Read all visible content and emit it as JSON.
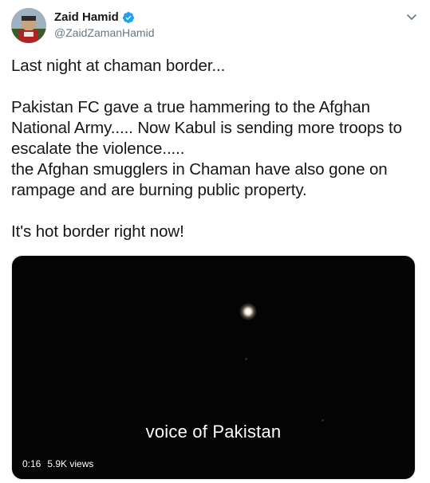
{
  "author": {
    "display_name": "Zaid Hamid",
    "handle": "@ZaidZamanHamid",
    "verified": true
  },
  "tweet": {
    "text": "Last night at chaman border...\n\nPakistan FC gave a true hammering to the Afghan National Army..... Now Kabul is sending more troops to escalate the violence.....\nthe Afghan smugglers in Chaman have also gone on rampage and are burning public property.\n\nIt's hot border right now!"
  },
  "media": {
    "caption": "voice of Pakistan",
    "duration": "0:16",
    "views": "5.9K views"
  },
  "colors": {
    "text": "#14171a",
    "secondary": "#657786",
    "verified": "#1da1f2",
    "video_bg": "#040404"
  },
  "icons": {
    "verified": "verified-badge-icon",
    "menu": "chevron-down-icon"
  }
}
